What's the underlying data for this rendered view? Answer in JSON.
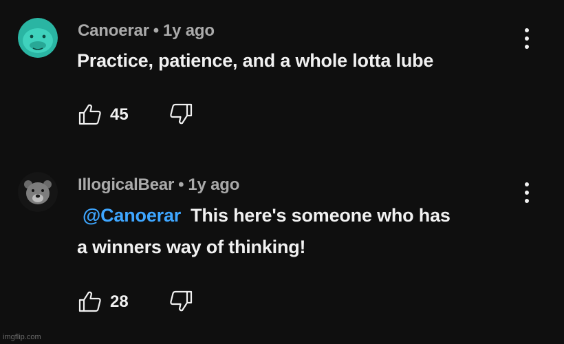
{
  "comments": [
    {
      "author": "Canoerar",
      "separator": "•",
      "time": "1y ago",
      "mention": "",
      "text": "Practice, patience, and a whole lotta lube",
      "text_line2": "",
      "likes": "45",
      "avatar_icon": "dolphin-avatar",
      "avatar_color": "#2ec4b0"
    },
    {
      "author": "IllogicalBear",
      "separator": "•",
      "time": "1y ago",
      "mention": "@Canoerar",
      "text": "This here's someone who has",
      "text_line2": "a winners way of thinking!",
      "likes": "28",
      "avatar_icon": "bear-avatar",
      "avatar_color": "#1b1b1b"
    }
  ],
  "colors": {
    "background": "#0f0f0f",
    "text": "#f1f1f1",
    "meta": "#aaaaaa",
    "mention": "#3ea6ff"
  },
  "icons": {
    "like": "thumbs-up-icon",
    "dislike": "thumbs-down-icon",
    "menu": "more-vertical-icon"
  },
  "watermark": "imgflip.com"
}
